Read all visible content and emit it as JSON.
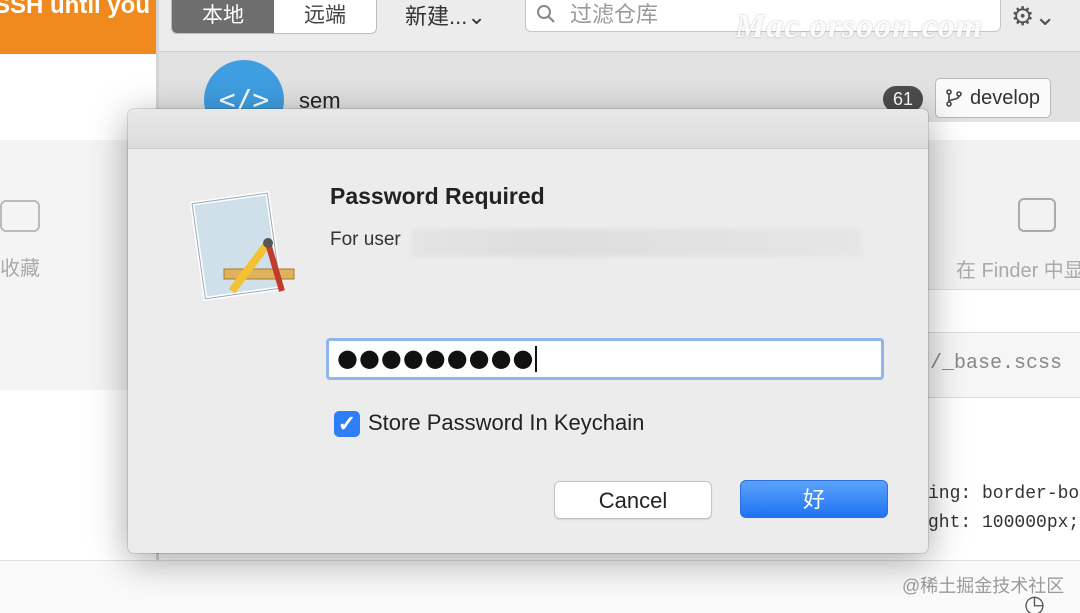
{
  "background": {
    "banner_text": "SSH until you",
    "toolbar": {
      "tab_local": "本地",
      "tab_remote": "远端",
      "new_menu": "新建...⌄",
      "search_placeholder": "过滤仓库",
      "watermark": "Mac.orsoon.com",
      "settings_icon": "gear-icon"
    },
    "repo": {
      "avatar_glyph": "</>",
      "name": "sem",
      "change_count": "61",
      "branch": "develop"
    },
    "left_panel_label": "收藏",
    "right_panel_label": "在 Finder 中显",
    "file_tab": "/_base.scss",
    "code_lines": [
      "ing: border-bo",
      "ght: 100000px;"
    ],
    "footer_watermark": "@稀土掘金技术社区"
  },
  "dialog": {
    "title": "Password Required",
    "user_prefix": "For user",
    "password_masked": "●●●●●●●●●",
    "store_checkbox_label": "Store Password In Keychain",
    "store_checked": true,
    "cancel_label": "Cancel",
    "ok_label": "好",
    "accent_color": "#2f7ef6"
  }
}
